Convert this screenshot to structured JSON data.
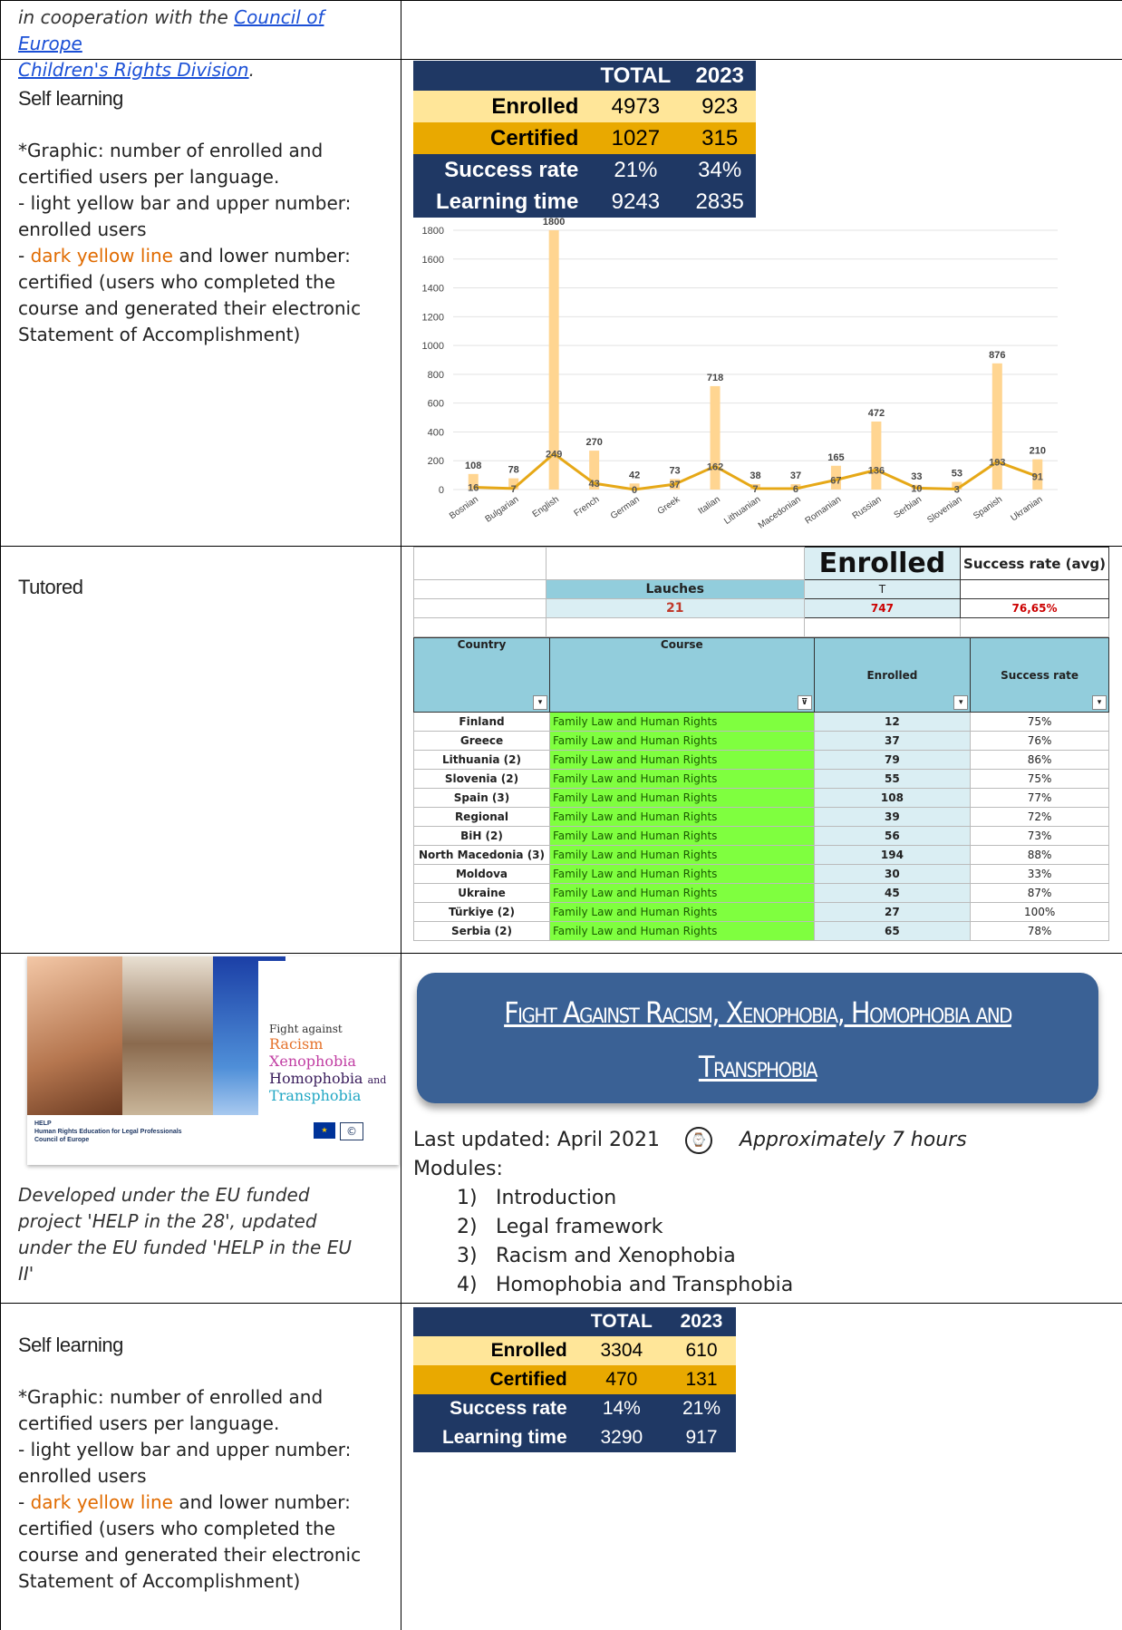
{
  "top_row": {
    "prefix": "in cooperation with the ",
    "link_line1": "Council of Europe ",
    "link_line2": "Children's Rights Division",
    "suffix": "."
  },
  "section1": {
    "heading": "Self learning",
    "note1": "*Graphic: number of enrolled and certified users per language.",
    "note2": "- light yellow bar and upper number: enrolled users",
    "note3_pre": "- ",
    "note3_orange": "dark yellow line",
    "note3_post": " and lower number: certified (users who completed the course and generated their electronic Statement of Accomplishment)",
    "stats": {
      "col_total": "TOTAL",
      "col_2023": "2023",
      "rows": [
        {
          "label": "Enrolled",
          "total": "4973",
          "y2023": "923"
        },
        {
          "label": "Certified",
          "total": "1027",
          "y2023": "315"
        },
        {
          "label": "Success rate",
          "total": "21%",
          "y2023": "34%"
        },
        {
          "label": "Learning time",
          "total": "9243",
          "y2023": "2835"
        }
      ]
    }
  },
  "chart_data": {
    "type": "bar",
    "categories": [
      "Bosnian",
      "Bulgarian",
      "English",
      "French",
      "German",
      "Greek",
      "Italian",
      "Lithuanian",
      "Macedonian",
      "Romanian",
      "Russian",
      "Serbian",
      "Slovenian",
      "Spanish",
      "Ukranian"
    ],
    "series": [
      {
        "values": [
          108,
          78,
          1800,
          270,
          42,
          73,
          718,
          38,
          37,
          165,
          472,
          33,
          53,
          876,
          210
        ],
        "color": "#ffd591",
        "kind": "bar"
      },
      {
        "values": [
          16,
          7,
          249,
          43,
          0,
          37,
          162,
          7,
          6,
          67,
          136,
          10,
          3,
          193,
          91
        ],
        "color": "#e6a817",
        "kind": "line"
      }
    ],
    "ylim": [
      0,
      1800
    ],
    "yticks": [
      0,
      200,
      400,
      600,
      800,
      1000,
      1200,
      1400,
      1600,
      1800
    ],
    "grid": true
  },
  "tutored": {
    "heading": "Tutored",
    "enrolled_title": "Enrolled",
    "success_avg_title": "Success rate (avg)",
    "launches_label": "Lauches",
    "launches_value": "21",
    "t_label": "T",
    "enrolled_total": "747",
    "success_avg": "76,65%",
    "col_country": "Country",
    "col_course": "Course",
    "col_enrolled": "Enrolled",
    "col_success": "Success rate",
    "rows": [
      {
        "country": "Finland",
        "course": "Family Law and Human Rights",
        "enrolled": "12",
        "rate": "75%"
      },
      {
        "country": "Greece",
        "course": "Family Law and Human Rights",
        "enrolled": "37",
        "rate": "76%"
      },
      {
        "country": "Lithuania (2)",
        "course": "Family Law and Human Rights",
        "enrolled": "79",
        "rate": "86%"
      },
      {
        "country": "Slovenia (2)",
        "course": "Family Law and Human Rights",
        "enrolled": "55",
        "rate": "75%"
      },
      {
        "country": "Spain (3)",
        "course": "Family Law and Human Rights",
        "enrolled": "108",
        "rate": "77%"
      },
      {
        "country": "Regional",
        "course": "Family Law and Human Rights",
        "enrolled": "39",
        "rate": "72%"
      },
      {
        "country": "BiH (2)",
        "course": "Family Law and Human Rights",
        "enrolled": "56",
        "rate": "73%"
      },
      {
        "country": "North Macedonia (3)",
        "course": "Family Law and Human Rights",
        "enrolled": "194",
        "rate": "88%"
      },
      {
        "country": "Moldova",
        "course": "Family Law and Human Rights",
        "enrolled": "30",
        "rate": "33%"
      },
      {
        "country": "Ukraine",
        "course": "Family Law and Human Rights",
        "enrolled": "45",
        "rate": "87%"
      },
      {
        "country": "Türkiye (2)",
        "course": "Family Law and Human Rights",
        "enrolled": "27",
        "rate": "100%"
      },
      {
        "country": "Serbia (2)",
        "course": "Family Law and Human Rights",
        "enrolled": "65",
        "rate": "78%"
      }
    ]
  },
  "course": {
    "cover_title": "Fight against",
    "cover_words": [
      "Racism",
      "Xenophobia",
      "Homophobia",
      "Transphobia"
    ],
    "cover_and": "and",
    "cover_help": "HELP",
    "cover_sub1": "Human Rights Education for Legal Professionals",
    "cover_sub2": "Council of Europe",
    "developed_note": "Developed under the EU funded project 'HELP in the 28', updated under the EU funded 'HELP in the EU II'",
    "banner_line1": "Fight Against Racism, Xenophobia, Homophobia and",
    "banner_line2": "Transphobia",
    "last_updated": "Last updated: April 2021",
    "duration": "Approximately 7 hours",
    "modules_label": "Modules:",
    "modules": [
      {
        "num": "1)",
        "name": "Introduction"
      },
      {
        "num": "2)",
        "name": "Legal framework"
      },
      {
        "num": "3)",
        "name": "Racism and Xenophobia"
      },
      {
        "num": "4)",
        "name": "Homophobia and Transphobia"
      }
    ]
  },
  "section2": {
    "heading": "Self learning",
    "note1": "*Graphic: number of enrolled and certified users per language.",
    "note2": "- light yellow bar and upper number: enrolled users",
    "note3_pre": "- ",
    "note3_orange": "dark yellow line",
    "note3_post": " and lower number: certified (users who completed the course and generated their electronic Statement of Accomplishment)",
    "stats": {
      "col_total": "TOTAL",
      "col_2023": "2023",
      "rows": [
        {
          "label": "Enrolled",
          "total": "3304",
          "y2023": "610"
        },
        {
          "label": "Certified",
          "total": "470",
          "y2023": "131"
        },
        {
          "label": "Success rate",
          "total": "14%",
          "y2023": "21%"
        },
        {
          "label": "Learning time",
          "total": "3290",
          "y2023": "917"
        }
      ]
    }
  }
}
